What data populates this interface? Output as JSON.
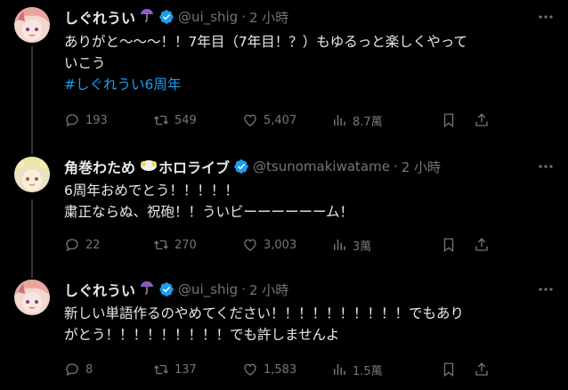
{
  "tweets": [
    {
      "name": "しぐれうい",
      "name_emoji": "umbrella-icon",
      "handle": "@ui_shig",
      "dot": "·",
      "time": "2 小時",
      "text": "ありがと〜〜〜！！7年目（7年目！？）もゆるっと楽しくやって\nいこう",
      "hashtag": "#しぐれうい6周年",
      "replies": "193",
      "retweets": "549",
      "likes": "5,407",
      "views": "8.7萬"
    },
    {
      "name": "角巻わため",
      "name_suffix": "ホロライブ",
      "name_emoji": "sheep-icon",
      "handle": "@tsunomakiwatame",
      "dot": "·",
      "time": "2 小時",
      "text": "6周年おめでとう！！！！！\n粛正ならぬ、祝砲！！ういビーーーーーーム！",
      "replies": "22",
      "retweets": "270",
      "likes": "3,003",
      "views": "3萬"
    },
    {
      "name": "しぐれうい",
      "name_emoji": "umbrella-icon",
      "handle": "@ui_shig",
      "dot": "·",
      "time": "2 小時",
      "text": "新しい単語作るのやめてください！！！！！！！！！！でもあり\nがとう！！！！！！！！！でも許しませんよ",
      "replies": "8",
      "retweets": "137",
      "likes": "1,583",
      "views": "1.5萬"
    }
  ],
  "colors": {
    "background": "#000000",
    "text": "#e7e9ea",
    "muted": "#71767b",
    "link": "#1d9bf0",
    "verified": "#1d9bf0"
  }
}
